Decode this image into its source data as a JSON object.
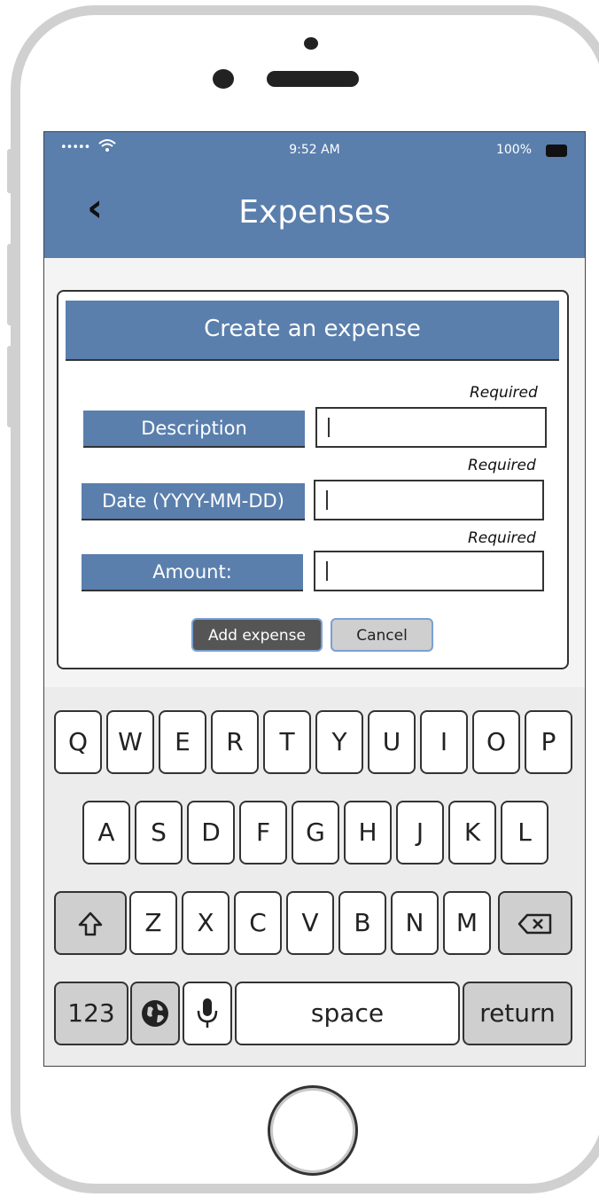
{
  "status_bar": {
    "signal": "•••••",
    "wifi_icon": "wifi-icon",
    "time": "9:52 AM",
    "battery": "100%"
  },
  "nav": {
    "back_icon": "chevron-left-icon",
    "title": "Expenses"
  },
  "dialog": {
    "title": "Create an expense",
    "fields": [
      {
        "label": "Description",
        "required": "Required",
        "value": ""
      },
      {
        "label": "Date (YYYY-MM-DD)",
        "required": "Required",
        "value": ""
      },
      {
        "label": "Amount:",
        "required": "Required",
        "value": ""
      }
    ],
    "add_button": "Add expense",
    "cancel_button": "Cancel"
  },
  "keyboard": {
    "row1": [
      "Q",
      "W",
      "E",
      "R",
      "T",
      "Y",
      "U",
      "I",
      "O",
      "P"
    ],
    "row2": [
      "A",
      "S",
      "D",
      "F",
      "G",
      "H",
      "J",
      "K",
      "L"
    ],
    "row3": [
      "Z",
      "X",
      "C",
      "V",
      "B",
      "N",
      "M"
    ],
    "numbers": "123",
    "space": "space",
    "return": "return",
    "shift_icon": "shift-icon",
    "backspace_icon": "backspace-icon",
    "globe_icon": "globe-icon",
    "mic_icon": "microphone-icon"
  },
  "colors": {
    "accent": "#5a7fad",
    "key_dark": "#cfcfcf"
  }
}
